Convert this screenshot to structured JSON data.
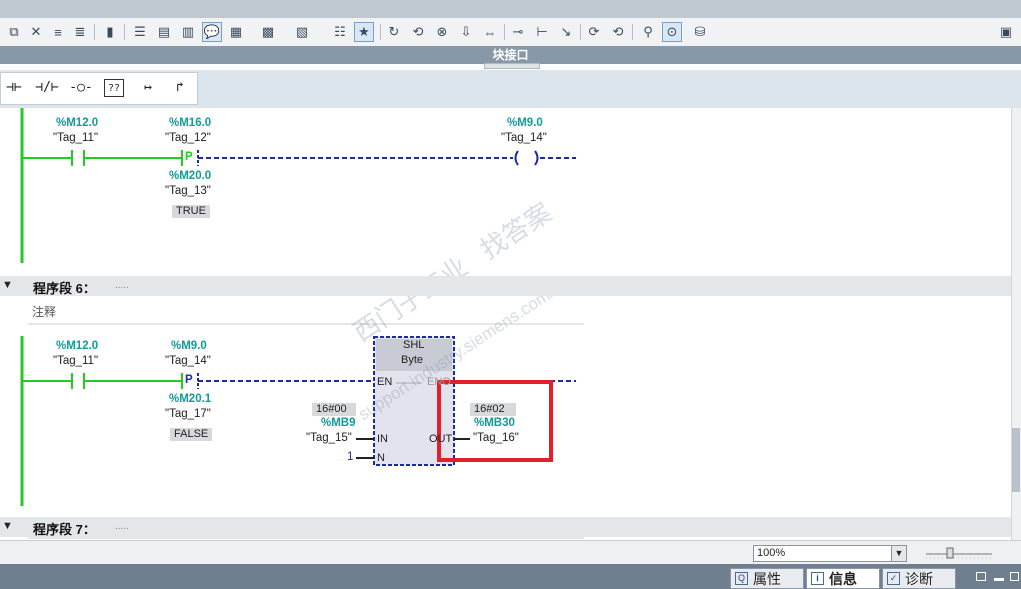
{
  "window": {
    "title": "块接口"
  },
  "toolbar_icons": [
    "insert-network-icon",
    "delete-network-icon",
    "insert-row-icon",
    "append-row-icon",
    "block-icon",
    "absolute-operands-icon",
    "networks-on-icon",
    "networks-off-icon",
    "comments-toggle-icon",
    "load-icon",
    "load-to-icon",
    "monitor-icon",
    "monitor-all-icon",
    "list-icon",
    "favorites-icon",
    "go-to-icon",
    "connect-icon",
    "disconnect-icon",
    "download-icon",
    "compare-icon",
    "breakpoint-icon",
    "step-icon",
    "step-out-icon",
    "run-icon",
    "monitoring-icon",
    "glasses-icon",
    "simulation-icon"
  ],
  "palette": {
    "no_contact": "⊣⊢",
    "nc_contact": "⊣/⊢",
    "coil": "-○-",
    "empty_box": "??",
    "open_branch": "↦",
    "close_branch": "↱"
  },
  "net5": {
    "c1": {
      "addr": "%M12.0",
      "name": "\"Tag_11\""
    },
    "c2": {
      "addr": "%M16.0",
      "name": "\"Tag_12\"",
      "sym": "P",
      "addr2": "%M20.0",
      "name2": "\"Tag_13\"",
      "val": "TRUE"
    },
    "coil": {
      "addr": "%M9.0",
      "name": "\"Tag_14\""
    }
  },
  "net6": {
    "header": "程序段 6：",
    "dots": ".....",
    "comment": "注释",
    "c1": {
      "addr": "%M12.0",
      "name": "\"Tag_11\""
    },
    "c2": {
      "addr": "%M9.0",
      "name": "\"Tag_14\"",
      "sym": "P",
      "addr2": "%M20.1",
      "name2": "\"Tag_17\"",
      "val": "FALSE"
    },
    "box": {
      "title": "SHL",
      "type": "Byte",
      "en": "EN",
      "eno": "ENO",
      "in": "IN",
      "n": "N",
      "out": "OUT"
    },
    "in_val": "16#00",
    "in_addr": "%MB9",
    "in_name": "\"Tag_15\"",
    "n_val": "1",
    "out_val": "16#02",
    "out_addr": "%MB30",
    "out_name": "\"Tag_16\""
  },
  "net7": {
    "header": "程序段 7：",
    "dots": "....."
  },
  "watermark": {
    "cn": "西门子工业 找答案",
    "url": "support.industry.siemens.com/cs"
  },
  "zoom": {
    "value": "100%"
  },
  "bottom_tabs": [
    {
      "label": "属性"
    },
    {
      "label": "信息"
    },
    {
      "label": "诊断"
    }
  ],
  "colors": {
    "highlight": "#e0202a",
    "power_rail": "#22cc22",
    "wire": "#1a2aa8",
    "address": "#139a9a"
  }
}
